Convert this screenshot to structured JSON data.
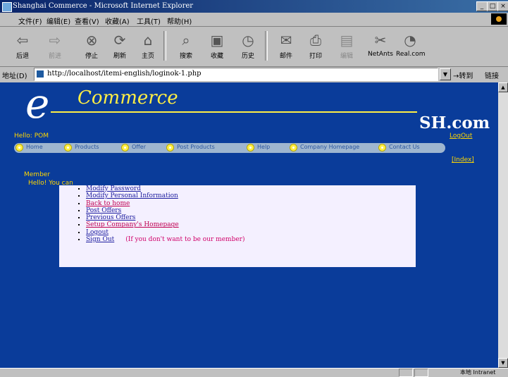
{
  "window": {
    "title": "Shanghai Commerce - Microsoft Internet Explorer"
  },
  "menu": [
    "文件(F)",
    "编辑(E)",
    "查看(V)",
    "收藏(A)",
    "工具(T)",
    "帮助(H)"
  ],
  "toolbar": {
    "back": "后退",
    "forward": "前进",
    "stop": "停止",
    "refresh": "刷新",
    "home": "主页",
    "search": "搜索",
    "favorites": "收藏",
    "history": "历史",
    "mail": "邮件",
    "print": "打印",
    "edit": "编辑",
    "netants": "NetAnts",
    "realcom": "Real.com"
  },
  "address": {
    "label": "地址(D)",
    "url": "http://localhost/itemi-english/loginok-1.php",
    "go": "转到",
    "links": "链接"
  },
  "header": {
    "logo_e": "e",
    "logo_text": "Commerce",
    "site": "SH.com",
    "logout": "LogOut",
    "hello": "Hello: POM"
  },
  "nav": [
    "Home",
    "Products",
    "Offer",
    "Post Products",
    "Help",
    "Company Homepage",
    "Contact Us"
  ],
  "page": {
    "topright_link": "[Index]",
    "member": "Member",
    "you_can": "Hello! You can",
    "options": [
      {
        "text": "Modify Password",
        "style": "blue"
      },
      {
        "text": "Modify Personal Information",
        "style": "blue"
      },
      {
        "text": "Back to home",
        "style": "red"
      },
      {
        "text": "Post Offers",
        "style": "blue"
      },
      {
        "text": "Previous Offers",
        "style": "blue"
      },
      {
        "text": "Setup Company's Homepage",
        "style": "red"
      },
      {
        "text": "Logout",
        "style": "blue"
      },
      {
        "text": "Sign Out",
        "style": "blue",
        "note": "(If you don't want to be our member)"
      }
    ]
  },
  "status": {
    "zone": "本地 Intranet"
  }
}
